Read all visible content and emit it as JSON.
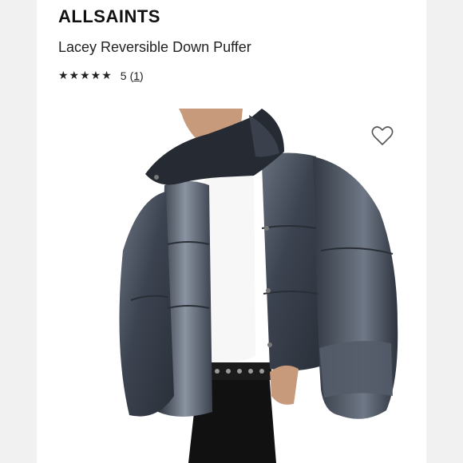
{
  "product": {
    "brand": "ALLSAINTS",
    "title": "Lacey Reversible Down Puffer",
    "rating": {
      "stars": "★★★★★",
      "score": "5",
      "count_prefix": "(",
      "count": "1",
      "count_suffix": ")"
    }
  },
  "icons": {
    "favorite": "heart-outline-icon"
  },
  "colors": {
    "background": "#f1f1f1",
    "card": "#ffffff",
    "text": "#111111",
    "jacket": "#3e4550"
  }
}
